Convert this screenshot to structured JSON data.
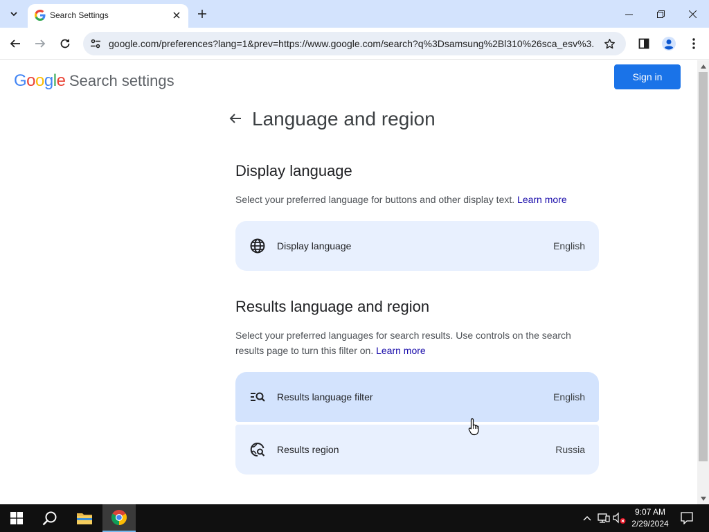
{
  "browser": {
    "tab_title": "Search Settings",
    "url": "google.com/preferences?lang=1&prev=https://www.google.com/search?q%3Dsamsung%2Bl310%26sca_esv%3..."
  },
  "header": {
    "logo_letters": [
      "G",
      "o",
      "o",
      "g",
      "l",
      "e"
    ],
    "app_title": "Search settings",
    "sign_in_label": "Sign in"
  },
  "main": {
    "title": "Language and region",
    "display_section": {
      "title": "Display language",
      "description": "Select your preferred language for buttons and other display text.",
      "learn_more": "Learn more",
      "card": {
        "label": "Display language",
        "value": "English",
        "icon": "globe-icon"
      }
    },
    "results_section": {
      "title": "Results language and region",
      "description": "Select your preferred languages for search results. Use controls on the search results page to turn this filter on.",
      "learn_more": "Learn more",
      "cards": [
        {
          "label": "Results language filter",
          "value": "English",
          "icon": "filter-search-icon"
        },
        {
          "label": "Results region",
          "value": "Russia",
          "icon": "region-search-icon"
        }
      ]
    }
  },
  "taskbar": {
    "time": "9:07 AM",
    "date": "2/29/2024"
  },
  "colors": {
    "accent": "#1a73e8",
    "card_bg": "#e8f0fe",
    "card_hover_bg": "#d3e3fd",
    "tabstrip_bg": "#d3e3fd",
    "link": "#1a0dab"
  }
}
